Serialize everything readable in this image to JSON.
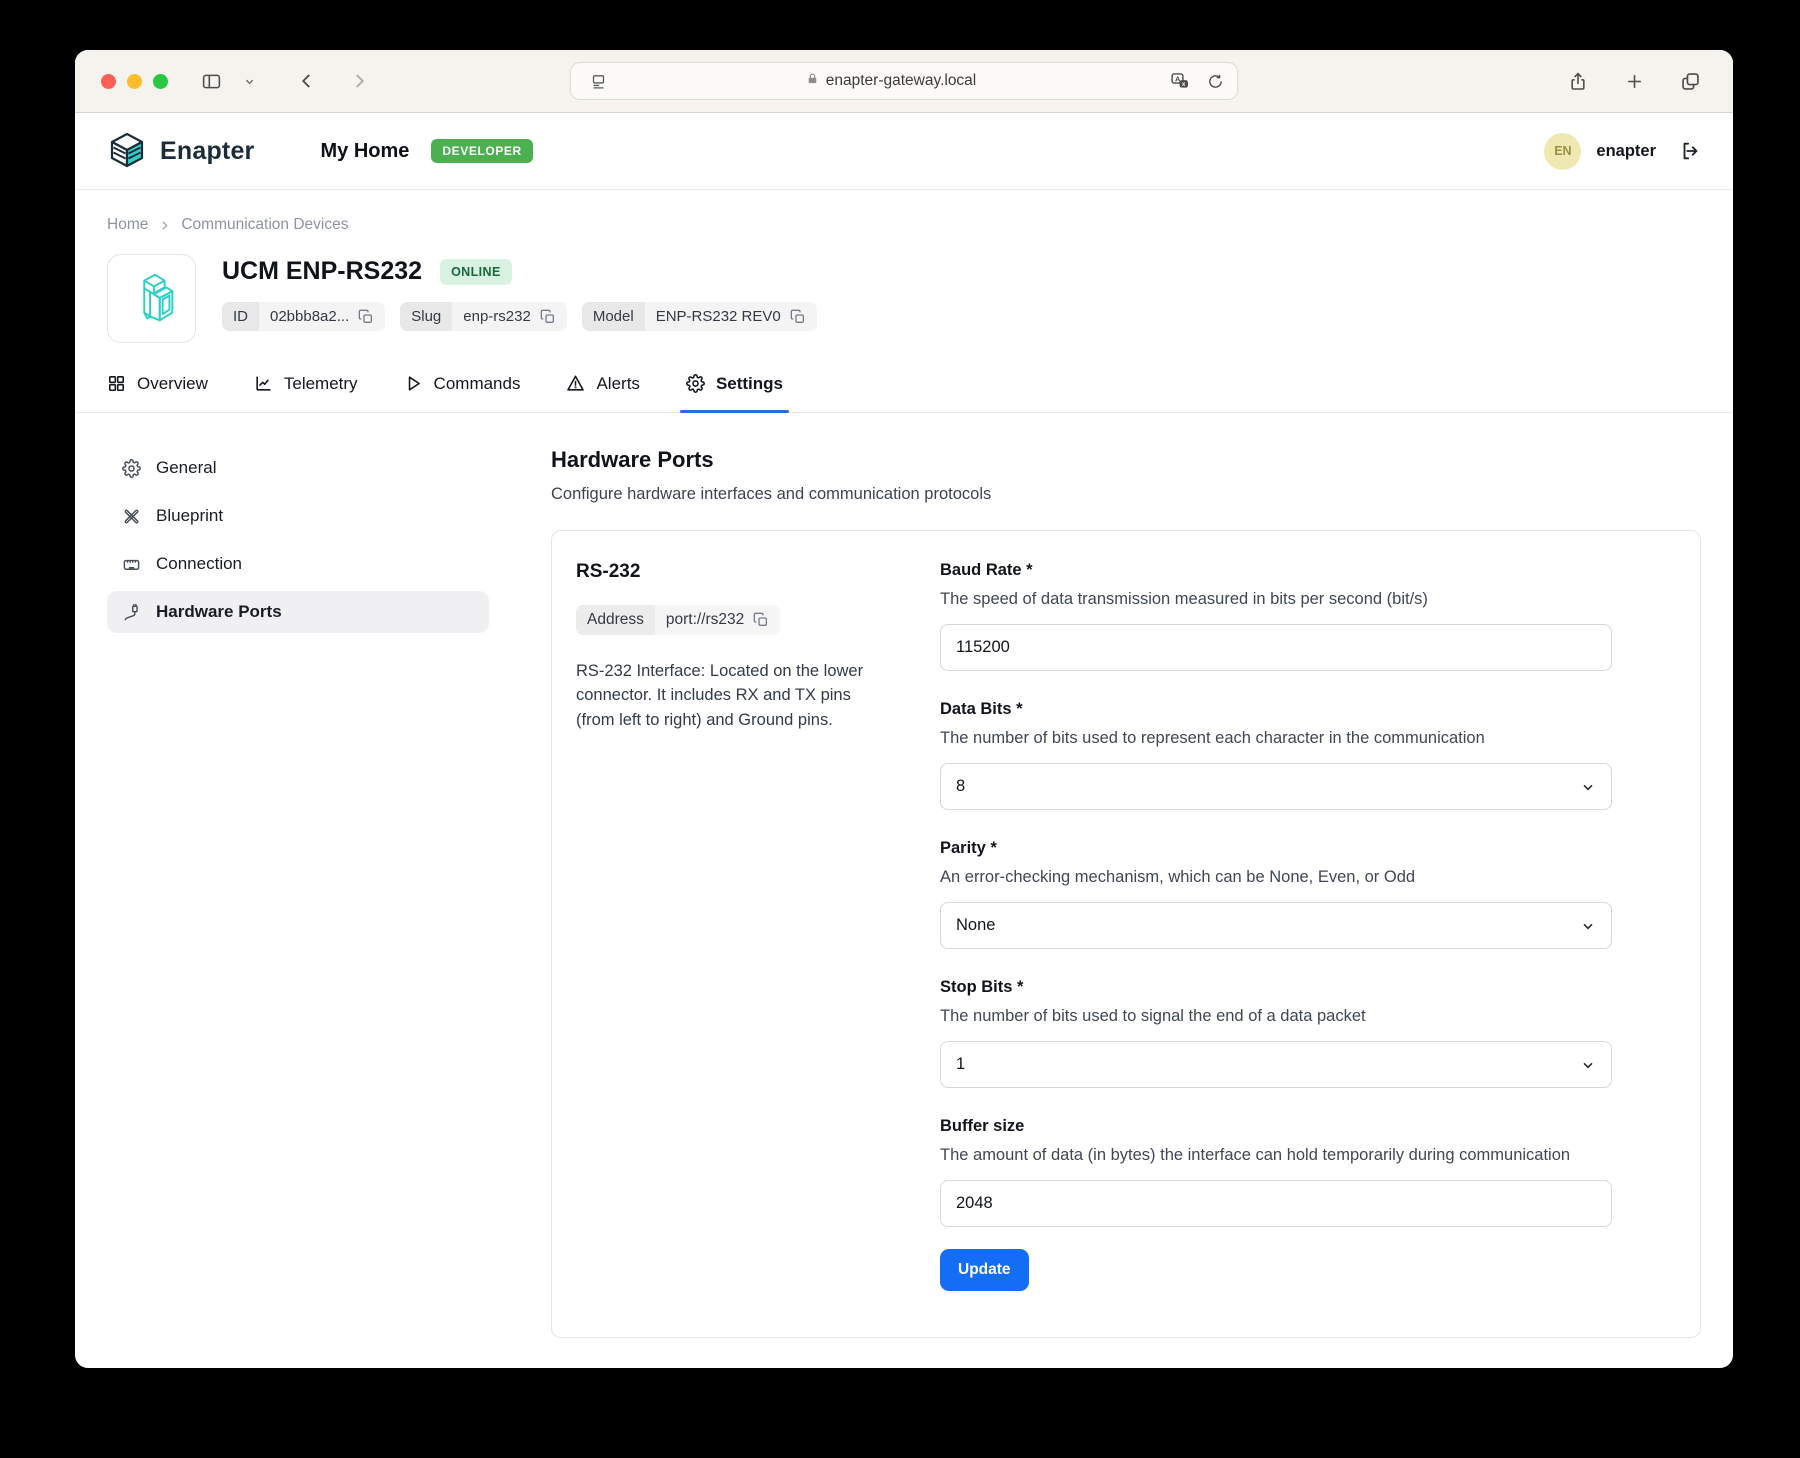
{
  "browser": {
    "url": "enapter-gateway.local"
  },
  "app_header": {
    "brand": "Enapter",
    "page": "My Home",
    "role_badge": "DEVELOPER",
    "user_initials": "EN",
    "user_name": "enapter"
  },
  "breadcrumb": {
    "items": [
      {
        "label": "Home"
      },
      {
        "label": "Communication Devices"
      }
    ]
  },
  "device": {
    "name": "UCM ENP-RS232",
    "status": "ONLINE",
    "meta": [
      {
        "label": "ID",
        "value": "02bbb8a2..."
      },
      {
        "label": "Slug",
        "value": "enp-rs232"
      },
      {
        "label": "Model",
        "value": "ENP-RS232 REV0"
      }
    ]
  },
  "tabs": [
    {
      "label": "Overview"
    },
    {
      "label": "Telemetry"
    },
    {
      "label": "Commands"
    },
    {
      "label": "Alerts"
    },
    {
      "label": "Settings",
      "active": true
    }
  ],
  "settings_nav": [
    {
      "label": "General"
    },
    {
      "label": "Blueprint"
    },
    {
      "label": "Connection"
    },
    {
      "label": "Hardware Ports",
      "active": true
    }
  ],
  "main": {
    "title": "Hardware Ports",
    "subtitle": "Configure hardware interfaces and communication protocols",
    "section": {
      "title": "RS-232",
      "address_label": "Address",
      "address_value": "port://rs232",
      "description": "RS-232 Interface: Located on the lower connector. It includes RX and TX pins (from left to right) and Ground pins."
    },
    "fields": [
      {
        "label": "Baud Rate *",
        "help": "The speed of data transmission measured in bits per second (bit/s)",
        "value": "115200",
        "type": "input"
      },
      {
        "label": "Data Bits *",
        "help": "The number of bits used to represent each character in the communication",
        "value": "8",
        "type": "select"
      },
      {
        "label": "Parity *",
        "help": "An error-checking mechanism, which can be None, Even, or Odd",
        "value": "None",
        "type": "select"
      },
      {
        "label": "Stop Bits *",
        "help": "The number of bits used to signal the end of a data packet",
        "value": "1",
        "type": "select"
      },
      {
        "label": "Buffer size",
        "help": "The amount of data (in bytes) the interface can hold temporarily during communication",
        "value": "2048",
        "type": "input"
      }
    ],
    "update_label": "Update"
  },
  "colors": {
    "accent_blue": "#146ef5",
    "tab_underline_blue": "#2e6be8",
    "badge_green": "#4caf50",
    "online_bg": "#d8f2e1",
    "online_text": "#17693d",
    "brand_teal": "#2fd2c8",
    "avatar_bg": "#efe9b1"
  }
}
